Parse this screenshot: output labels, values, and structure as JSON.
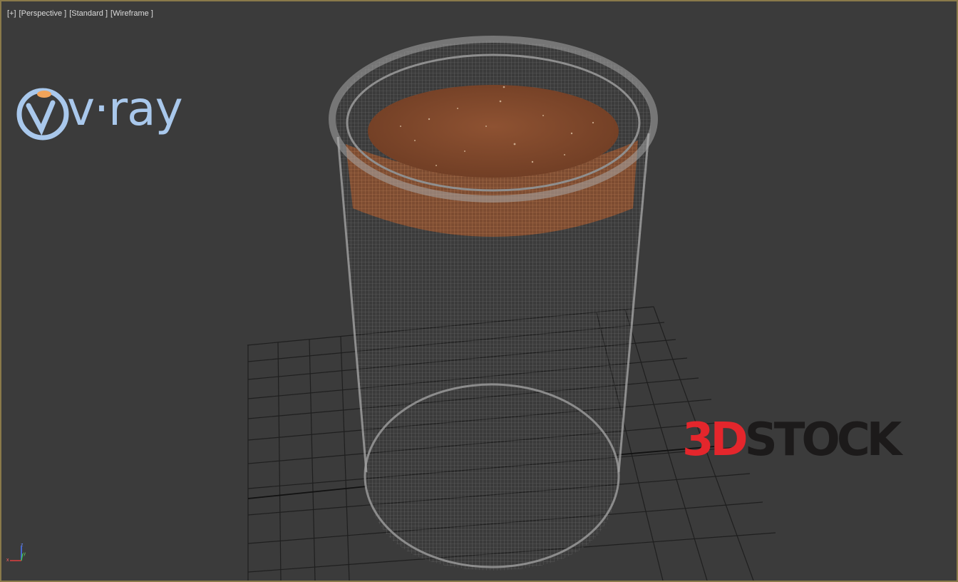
{
  "viewport": {
    "labels": {
      "menu": "[+]",
      "view": "[Perspective ]",
      "shading": "[Standard ]",
      "mode": "[Wireframe ]"
    },
    "active_border_color": "#8a7a4a",
    "background_color": "#3b3b3b"
  },
  "watermarks": {
    "vray": {
      "text": "v·ray",
      "color": "#a9c8ec"
    },
    "stock": {
      "part1": "3D",
      "part2": "STOCK",
      "accent": "#e4262c",
      "dark": "#1c1a1a"
    }
  },
  "gizmo": {
    "z": "z",
    "y": "y",
    "x": "x"
  },
  "model": {
    "object": "glass jar with cork lid",
    "glass_wire_color": "#9a9a9a",
    "cork_color": "#8a5030"
  }
}
